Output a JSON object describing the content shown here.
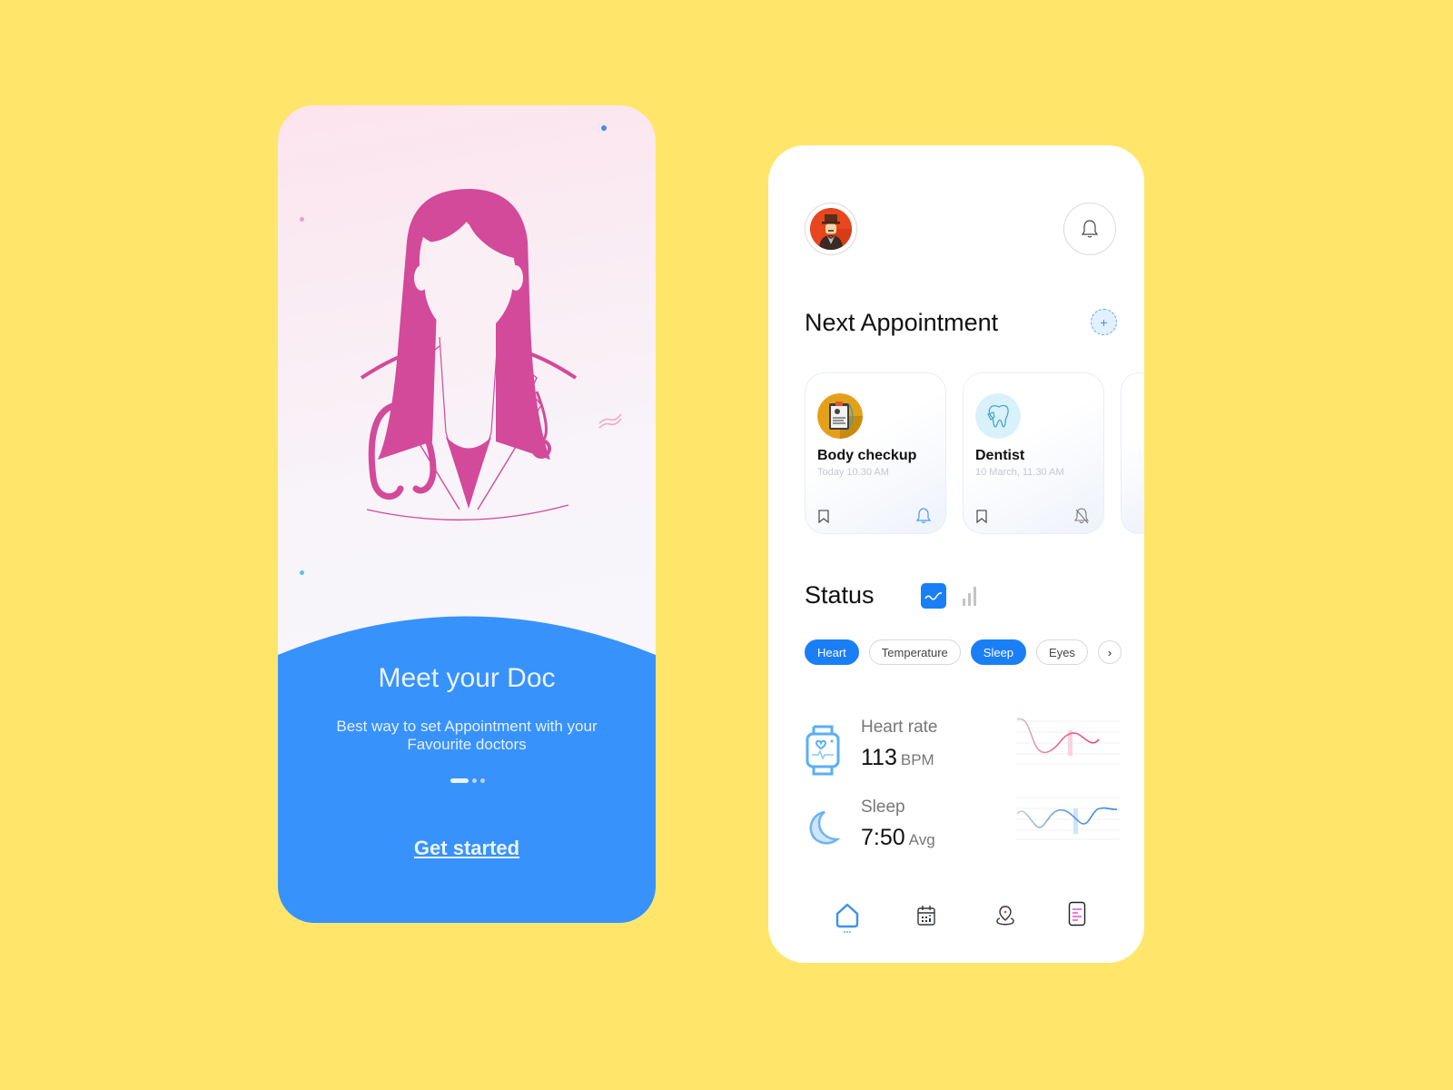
{
  "onboarding": {
    "title": "Meet your Doc",
    "subtitle": "Best way to set Appointment with your Favourite doctors",
    "pager": {
      "total": 3,
      "current": 1
    },
    "cta_label": "Get started",
    "illustration": "doctor-illustration",
    "colors": {
      "primary": "#3792FC",
      "illustration": "#D34A9A"
    }
  },
  "dashboard": {
    "header": {
      "avatar": "user-avatar",
      "notification_icon": "bell-icon"
    },
    "next_appointment": {
      "title": "Next Appointment",
      "add_icon": "plus-icon",
      "cards": [
        {
          "title": "Body checkup",
          "time": "Today 10.30 AM",
          "icon": "clipboard-icon",
          "bookmark_icon": "bookmark-icon",
          "alert_icon": "bell-icon",
          "alert_on": true
        },
        {
          "title": "Dentist",
          "time": "10 March, 11.30 AM",
          "icon": "tooth-icon",
          "bookmark_icon": "bookmark-icon",
          "alert_icon": "bell-off-icon",
          "alert_on": false
        }
      ]
    },
    "status": {
      "title": "Status",
      "view_toggle": [
        {
          "icon": "line-chart-icon",
          "active": true
        },
        {
          "icon": "bar-chart-icon",
          "active": false
        }
      ],
      "chips": [
        {
          "label": "Heart",
          "active": true
        },
        {
          "label": "Temperature",
          "active": false
        },
        {
          "label": "Sleep",
          "active": true
        },
        {
          "label": "Eyes",
          "active": false
        }
      ],
      "more_icon": "chevron-right-icon",
      "metrics": [
        {
          "label": "Heart rate",
          "value": "113",
          "unit": "BPM",
          "icon": "smartwatch-icon",
          "color": "#F0457A"
        },
        {
          "label": "Sleep",
          "value": "7:50",
          "unit": "Avg",
          "icon": "moon-icon",
          "color": "#2E86E8"
        }
      ]
    },
    "nav": [
      {
        "name": "home",
        "icon": "home-icon",
        "active": true
      },
      {
        "name": "calendar",
        "icon": "calendar-icon",
        "active": false
      },
      {
        "name": "location",
        "icon": "location-pin-icon",
        "active": false
      },
      {
        "name": "records",
        "icon": "document-icon",
        "active": false
      }
    ],
    "accent": "#1A7FF7"
  }
}
